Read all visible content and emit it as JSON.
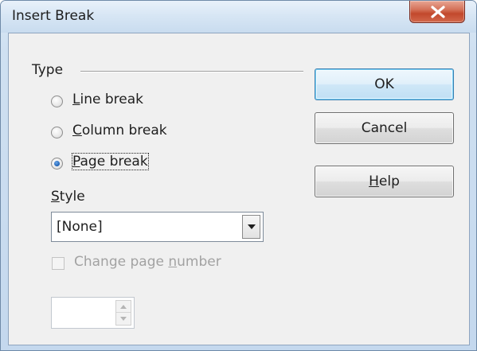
{
  "window": {
    "title": "Insert Break",
    "close_glyph": "X"
  },
  "type_group": {
    "label": "Type",
    "options": [
      {
        "label_ul": "L",
        "label_rest": "ine break",
        "checked": false
      },
      {
        "label_ul": "C",
        "label_rest": "olumn break",
        "checked": false
      },
      {
        "label_ul": "P",
        "label_rest": "age break",
        "checked": true
      }
    ]
  },
  "style": {
    "label_ul": "S",
    "label_rest": "tyle",
    "selected": "[None]"
  },
  "page_number": {
    "label_pre": "Change page ",
    "label_ul": "n",
    "label_post": "umber",
    "checked": false,
    "enabled": false,
    "value": ""
  },
  "buttons": {
    "ok": "OK",
    "cancel": "Cancel",
    "help_ul": "H",
    "help_rest": "elp"
  },
  "colors": {
    "accent_blue": "#1d5fb4",
    "close_red": "#c2482c"
  }
}
